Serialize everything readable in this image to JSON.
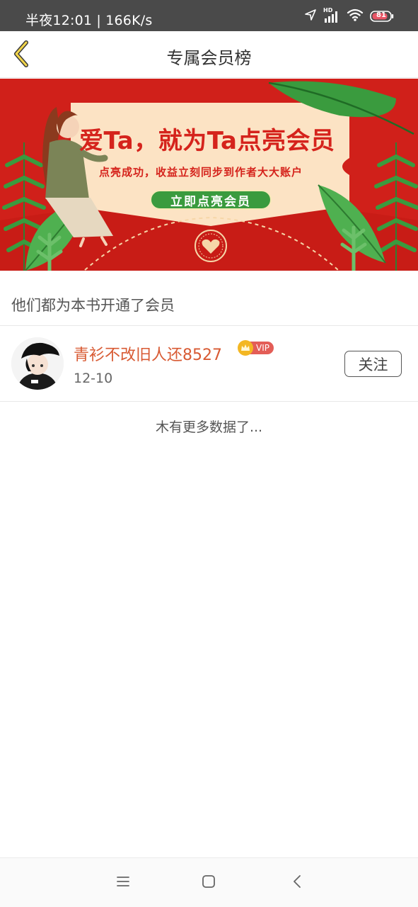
{
  "status_bar": {
    "time_speed": "半夜12:01 | 166K/s",
    "hd_label": "HD",
    "battery": "81"
  },
  "header": {
    "title": "专属会员榜"
  },
  "banner": {
    "headline": "爱Ta，就为Ta点亮会员",
    "subtitle": "点亮成功，收益立刻同步到作者大大账户",
    "button_label": "立即点亮会员",
    "colors": {
      "background": "#d0201a",
      "card": "#fce3c4",
      "button": "#3a9b3e"
    }
  },
  "section": {
    "title": "他们都为本书开通了会员"
  },
  "members": [
    {
      "name": "青衫不改旧人还8527",
      "badge": "VIP",
      "date": "12-10",
      "follow_label": "关注"
    }
  ],
  "footer": {
    "no_more": "木有更多数据了..."
  },
  "nav": {
    "icons": [
      "menu-icon",
      "home-square-icon",
      "back-chevron-icon"
    ]
  }
}
